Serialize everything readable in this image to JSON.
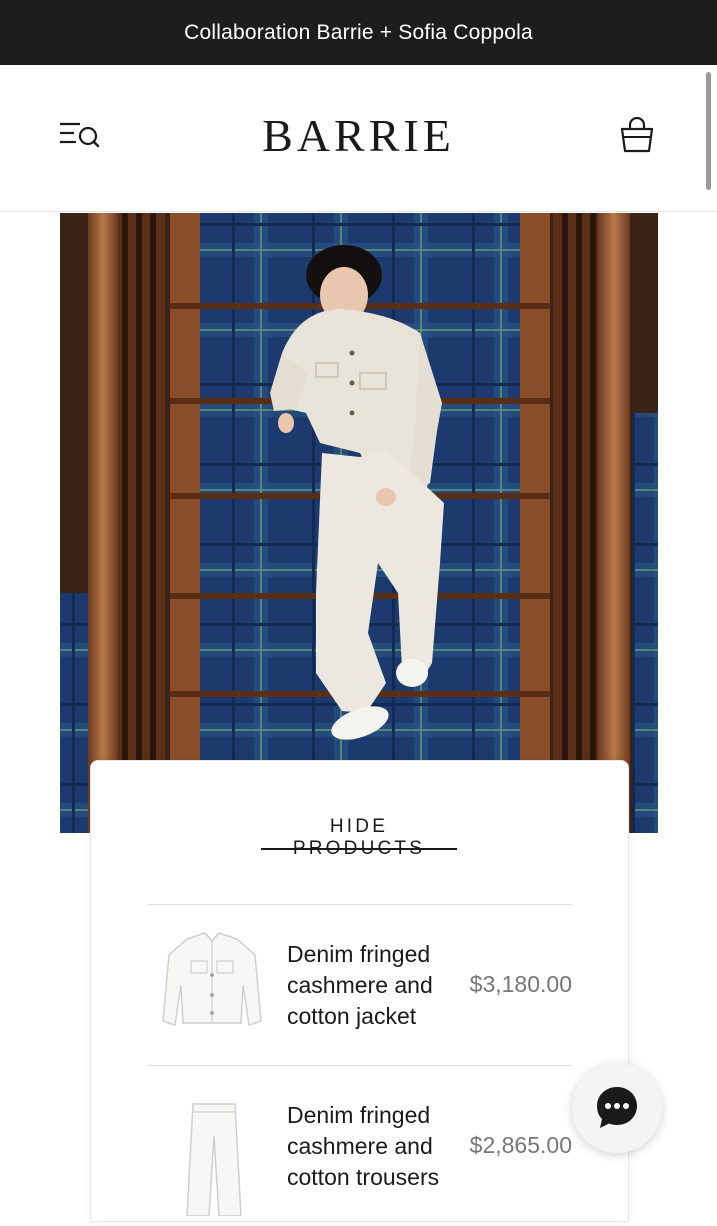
{
  "announcement": {
    "text": "Collaboration Barrie + Sofia Coppola"
  },
  "header": {
    "logo": "BARRIE",
    "menu_icon": "menu-search-icon",
    "bag_icon": "shopping-bag-icon"
  },
  "hero": {
    "image": "model-in-white-outfit-on-plaid-staircase"
  },
  "products_panel": {
    "hide_label": "HIDE PRODUCTS",
    "items": [
      {
        "name": "Denim fringed cashmere and cotton jacket",
        "price": "$3,180.00",
        "thumb_icon": "white-jacket-image"
      },
      {
        "name": "Denim fringed cashmere and cotton trousers",
        "price": "$2,865.00",
        "thumb_icon": "white-trousers-image"
      }
    ]
  },
  "chat": {
    "icon": "chat-bubble-icon"
  },
  "colors": {
    "announcement_bg": "#1f1d1b",
    "text": "#1a1a1a",
    "price": "#777777",
    "chat_bubble": "#1a1a1a"
  }
}
